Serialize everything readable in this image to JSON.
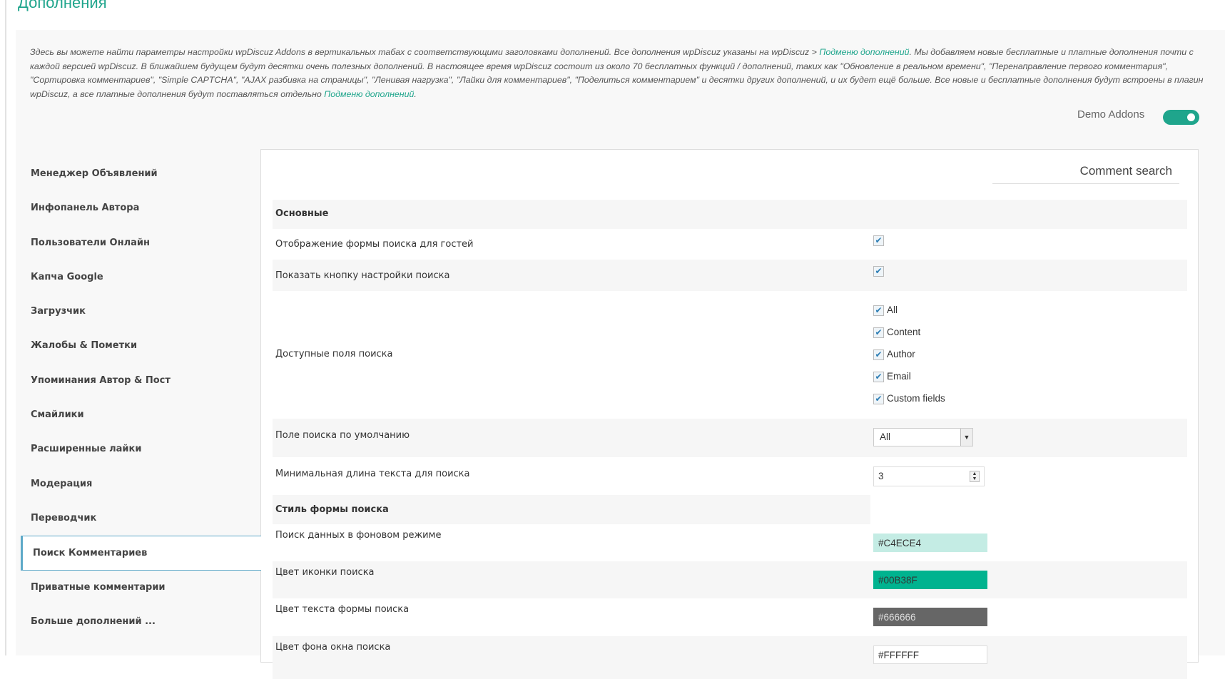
{
  "page_title": "Дополнения",
  "description": {
    "text1": "Здесь вы можете найти параметры настройки wpDiscuz Addons в вертикальных табах с соответствующими заголовками дополнений. Все дополнения wpDiscuz указаны на wpDiscuz > ",
    "link1": "Подменю дополнений",
    "text2": ". Мы добавляем новые бесплатные и платные дополнения почти с каждой версией wpDiscuz. В ближайшем будущем будут десятки очень полезных дополнений. В настоящее время wpDiscuz состоит из около 70 бесплатных функций / дополнений, таких как \"Обновление в реальном времени\", \"Перенаправление первого комментария\", \"Сортировка комментариев\", \"Simple CAPTCHA\", \"AJAX разбивка на страницы\", \"Ленивая нагрузка\", \"Лайки для комментариев\", \"Поделиться комментарием\" и десятки других дополнений, и их будет ещё больше. Все новые и бесплатные дополнения будут встроены в плагин wpDiscuz, а все платные дополнения будут поставляться отдельно ",
    "link2": "Подменю дополнений",
    "text3": "."
  },
  "demo_addons": {
    "label": "Demo Addons",
    "enabled": true
  },
  "sidebar": {
    "items": [
      {
        "label": "Менеджер Объявлений"
      },
      {
        "label": "Инфопанель Автора"
      },
      {
        "label": "Пользователи Онлайн"
      },
      {
        "label": "Капча Google"
      },
      {
        "label": "Загрузчик"
      },
      {
        "label": "Жалобы & Пометки"
      },
      {
        "label": "Упоминания Автор & Пост"
      },
      {
        "label": "Смайлики"
      },
      {
        "label": "Расширенные лайки"
      },
      {
        "label": "Модерация"
      },
      {
        "label": "Переводчик"
      },
      {
        "label": "Поиск Комментариев",
        "active": true
      },
      {
        "label": "Приватные комментарии"
      },
      {
        "label": "Больше дополнений ..."
      }
    ]
  },
  "panel": {
    "title": "Comment search",
    "section_main": "Основные",
    "guest_form": {
      "label": "Отображение формы поиска для гостей",
      "checked": true
    },
    "settings_button": {
      "label": "Показать кнопку настройки поиска",
      "checked": true
    },
    "fields": {
      "label": "Доступные поля поиска",
      "options": [
        {
          "label": "All",
          "checked": true
        },
        {
          "label": "Content",
          "checked": true
        },
        {
          "label": "Author",
          "checked": true
        },
        {
          "label": "Email",
          "checked": true
        },
        {
          "label": "Custom fields",
          "checked": true
        }
      ]
    },
    "default_field": {
      "label": "Поле поиска по умолчанию",
      "value": "All"
    },
    "min_length": {
      "label": "Минимальная длина текста для поиска",
      "value": "3"
    },
    "section_style": "Стиль формы поиска",
    "bg_search": {
      "label": "Поиск данных в фоновом режиме",
      "value": "#C4ECE4"
    },
    "icon_color": {
      "label": "Цвет иконки поиска",
      "value": "#00B38F"
    },
    "text_color": {
      "label": "Цвет текста формы поиска",
      "value": "#666666"
    },
    "window_bg": {
      "label": "Цвет фона окна поиска",
      "value": "#FFFFFF"
    }
  },
  "colors": {
    "accent": "#1fa58c",
    "active_border": "#5ea9c8"
  }
}
